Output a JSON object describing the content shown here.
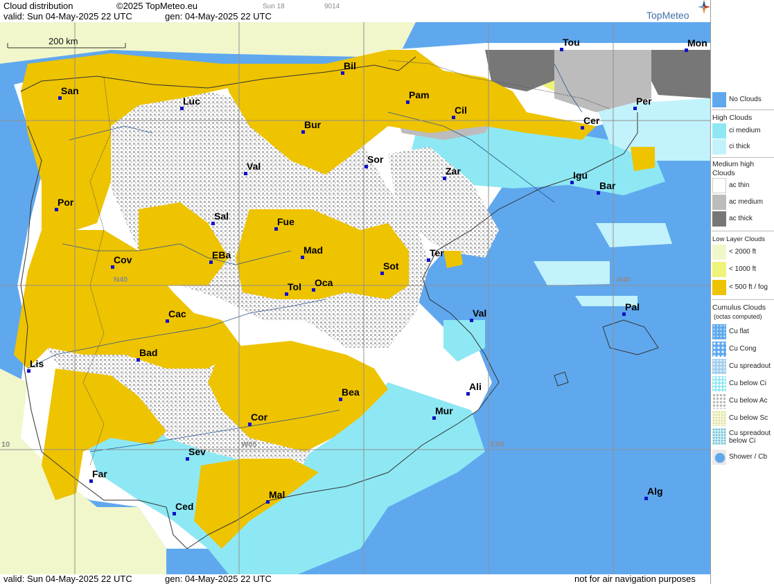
{
  "header": {
    "title": "Cloud distribution",
    "copyright": "©2025 TopMeteo.eu",
    "day_small": "Sun 18",
    "code_small": "9014",
    "valid_line": "valid:  Sun  04-May-2025  22 UTC",
    "gen_line": "gen: 04-May-2025 22 UTC",
    "brand": "TopMeteo"
  },
  "footer": {
    "valid_line": "valid:  Sun  04-May-2025  22 UTC",
    "gen_line": "gen: 04-May-2025 22 UTC",
    "disclaimer": "not for air navigation purposes"
  },
  "map": {
    "scale_label": "200 km",
    "grid_labels": [
      "N40",
      "N40",
      "W05",
      "E00",
      "10"
    ],
    "cities": [
      {
        "name": "San"
      },
      {
        "name": "Luc"
      },
      {
        "name": "Bil"
      },
      {
        "name": "Pam"
      },
      {
        "name": "Tou"
      },
      {
        "name": "Mon"
      },
      {
        "name": "Per"
      },
      {
        "name": "Cil"
      },
      {
        "name": "Cer"
      },
      {
        "name": "Bur"
      },
      {
        "name": "Sor"
      },
      {
        "name": "Val"
      },
      {
        "name": "Zar"
      },
      {
        "name": "Igu"
      },
      {
        "name": "Bar"
      },
      {
        "name": "Por"
      },
      {
        "name": "Sal"
      },
      {
        "name": "Fue"
      },
      {
        "name": "Mad"
      },
      {
        "name": "Ter"
      },
      {
        "name": "Cov"
      },
      {
        "name": "EBa"
      },
      {
        "name": "Sot"
      },
      {
        "name": "Tol"
      },
      {
        "name": "Oca"
      },
      {
        "name": "Pal"
      },
      {
        "name": "Cac"
      },
      {
        "name": "Val"
      },
      {
        "name": "Bad"
      },
      {
        "name": "Lis"
      },
      {
        "name": "Ali"
      },
      {
        "name": "Bea"
      },
      {
        "name": "Mur"
      },
      {
        "name": "Cor"
      },
      {
        "name": "Sev"
      },
      {
        "name": "Far"
      },
      {
        "name": "Mal"
      },
      {
        "name": "Alg"
      },
      {
        "name": "Ced"
      }
    ]
  },
  "legend": {
    "no_clouds": "No Clouds",
    "high_title": "High Clouds",
    "ci_medium": "ci medium",
    "ci_thick": "ci thick",
    "medium_title_1": "Medium high",
    "medium_title_2": "Clouds",
    "ac_thin": "ac thin",
    "ac_medium": "ac medium",
    "ac_thick": "ac thick",
    "low_title": "Low Layer Clouds",
    "low_2000": "< 2000 ft",
    "low_1000": "< 1000 ft",
    "low_500": "< 500 ft / fog",
    "cu_title_1": "Cumulus Clouds",
    "cu_title_2": "(octas computed)",
    "cu_flat": "Cu flat",
    "cu_cong": "Cu Cong",
    "cu_spreadout": "Cu spreadout",
    "cu_below_ci": "Cu below Ci",
    "cu_below_ac": "Cu below Ac",
    "cu_below_sc": "Cu below Sc",
    "cu_spread_ci_1": "Cu spreadout",
    "cu_spread_ci_2": "below Ci",
    "shower": "Shower / Cb"
  },
  "colors": {
    "no_clouds": "#5fa8ee",
    "ci_medium": "#8ee8f4",
    "ci_thick": "#c2f2fb",
    "ac_thin": "#ffffff",
    "ac_medium": "#bcbcbc",
    "ac_thick": "#777777",
    "low_2000": "#f1f7cb",
    "low_1000": "#eef37a",
    "low_500": "#eec300",
    "grid": "#909090",
    "city": "#1010c8"
  }
}
